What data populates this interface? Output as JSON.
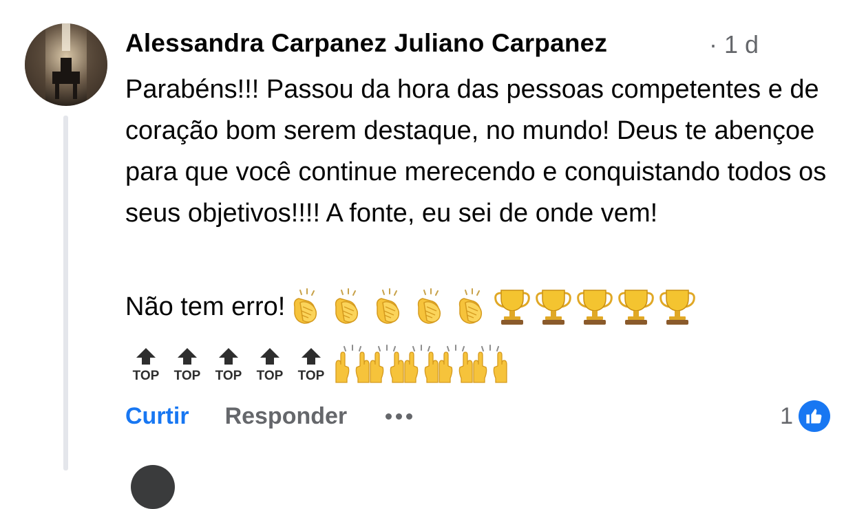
{
  "comment": {
    "author": "Alessandra Carpanez Juliano Carpanez",
    "dot": "·",
    "time": "1 d",
    "text": "Parabéns!!! Passou da hora das pessoas competentes e de coração bom serem destaque, no mundo! Deus te abençoe para que você continue merecendo e conquistando todos os seus objetivos!!!! A fonte, eu sei de onde vem!",
    "line2_text": "Não tem erro!",
    "line2_emoji": [
      "clapping-hands",
      "clapping-hands",
      "clapping-hands",
      "clapping-hands",
      "clapping-hands",
      "trophy",
      "trophy",
      "trophy",
      "trophy",
      "trophy"
    ],
    "row3_emoji": [
      "top-arrow",
      "top-arrow",
      "top-arrow",
      "top-arrow",
      "top-arrow",
      "raising-hands",
      "raising-hands",
      "raising-hands",
      "raising-hands",
      "raising-hands"
    ],
    "top_label": "TOP"
  },
  "actions": {
    "like": "Curtir",
    "reply": "Responder"
  },
  "reactions": {
    "count": "1",
    "type": "like-icon"
  },
  "colors": {
    "accent": "#1877f2",
    "secondary_text": "#65676b",
    "thread_line": "#e4e6eb"
  }
}
